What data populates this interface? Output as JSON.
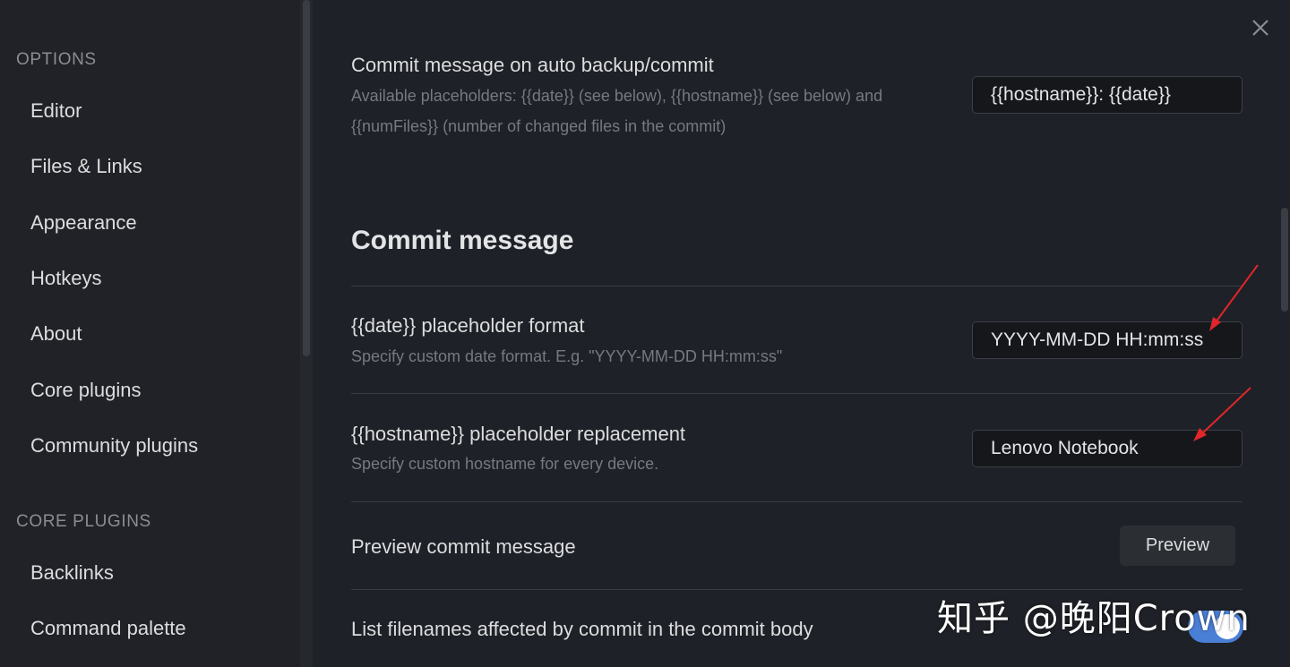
{
  "sidebar": {
    "options_title": "OPTIONS",
    "options_items": [
      "Editor",
      "Files & Links",
      "Appearance",
      "Hotkeys",
      "About",
      "Core plugins",
      "Community plugins"
    ],
    "core_plugins_title": "CORE PLUGINS",
    "core_plugins_items": [
      "Backlinks",
      "Command palette"
    ]
  },
  "main": {
    "auto_commit": {
      "name": "Commit message on auto backup/commit",
      "desc_line1": "Available placeholders: {{date}} (see below), {{hostname}} (see below) and",
      "desc_line2": "{{numFiles}} (number of changed files in the commit)",
      "value": "{{hostname}}: {{date}}"
    },
    "heading": "Commit message",
    "date_format": {
      "name": "{{date}} placeholder format",
      "desc": "Specify custom date format. E.g. \"YYYY-MM-DD HH:mm:ss\"",
      "value": "YYYY-MM-DD HH:mm:ss"
    },
    "hostname": {
      "name": "{{hostname}} placeholder replacement",
      "desc": "Specify custom hostname for every device.",
      "value": "Lenovo Notebook"
    },
    "preview": {
      "name": "Preview commit message",
      "button": "Preview"
    },
    "list_filenames": {
      "name": "List filenames affected by commit in the commit body",
      "enabled": true
    }
  },
  "watermark": "知乎 @晚阳Crown",
  "colors": {
    "background": "#1e2127",
    "sidebar": "#202227",
    "accent": "#4a7fd6",
    "annotation_arrow": "#e0262b"
  }
}
